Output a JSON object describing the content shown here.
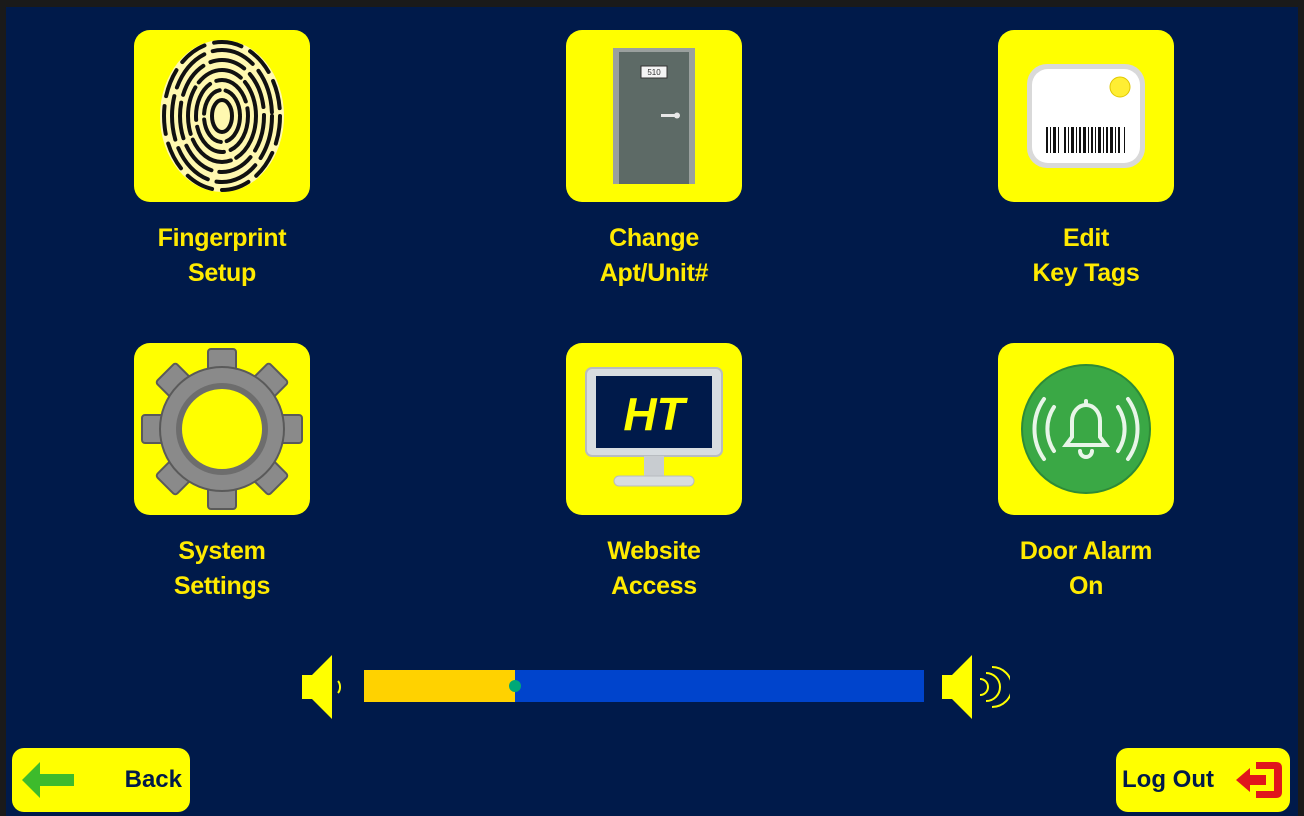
{
  "menu": {
    "fingerprint": {
      "line1": "Fingerprint",
      "line2": "Setup",
      "icon": "fingerprint-icon"
    },
    "apt_unit": {
      "line1": "Change",
      "line2": "Apt/Unit#",
      "icon": "door-icon",
      "door_number": "510"
    },
    "key_tags": {
      "line1": "Edit",
      "line2": "Key Tags",
      "icon": "key-tag-icon"
    },
    "system_settings": {
      "line1": "System",
      "line2": "Settings",
      "icon": "gear-icon"
    },
    "website_access": {
      "line1": "Website",
      "line2": "Access",
      "icon": "monitor-icon",
      "monitor_text": "HT"
    },
    "door_alarm": {
      "line1": "Door Alarm",
      "line2": "On",
      "icon": "bell-icon"
    }
  },
  "volume": {
    "level": 0.27,
    "low_icon": "speaker-low-icon",
    "high_icon": "speaker-high-icon"
  },
  "nav": {
    "back_label": "Back",
    "logout_label": "Log Out"
  },
  "colors": {
    "background": "#001a4a",
    "tile": "#ffff00",
    "label": "#ffea00",
    "track": "#0044cc",
    "fill": "#ffd200",
    "logout_icon": "#e0161c",
    "back_arrow": "#3dbb2c",
    "alarm_green": "#3aa845"
  }
}
